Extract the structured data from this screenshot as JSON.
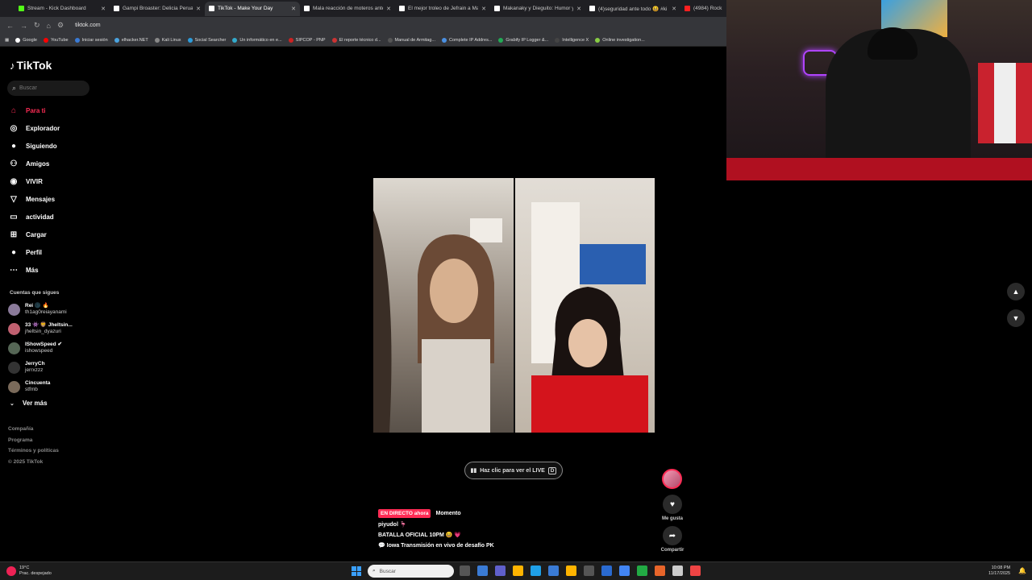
{
  "browser": {
    "tabs": [
      {
        "title": "Stream - Kick Dashboard",
        "color": "#53fc18",
        "active": false
      },
      {
        "title": "Gampi Broaster: Delicia Peruana",
        "color": "#ffffff",
        "active": false
      },
      {
        "title": "TikTok - Make Your Day",
        "color": "#ffffff",
        "active": true
      },
      {
        "title": "Mala reacción de moteros ante",
        "color": "#ffffff",
        "active": false
      },
      {
        "title": "El mejor troleo de Jefrain a Mai",
        "color": "#ffffff",
        "active": false
      },
      {
        "title": "Makanaky y Dieguito: Humor y",
        "color": "#ffffff",
        "active": false
      },
      {
        "title": "(4)seguridad ante todo 😆 #ki",
        "color": "#ffffff",
        "active": false
      },
      {
        "title": "(4984) Rock",
        "color": "#ff2020",
        "active": false
      }
    ],
    "url": "tiktok.com",
    "bookmarks": [
      {
        "label": "Google",
        "color": "#ffffff"
      },
      {
        "label": "YouTube",
        "color": "#ff0000"
      },
      {
        "label": "Iniciar sesión",
        "color": "#3a7bd5"
      },
      {
        "label": "elhacker.NET",
        "color": "#4aa3df"
      },
      {
        "label": "Kali Linux",
        "color": "#888888"
      },
      {
        "label": "Social Searcher",
        "color": "#2d9cdb"
      },
      {
        "label": "Un informático en e...",
        "color": "#33aacc"
      },
      {
        "label": "SIPCOP - PNP",
        "color": "#cc2222"
      },
      {
        "label": "El reporte técnico d...",
        "color": "#cc3333"
      },
      {
        "label": "Manual de Armitag...",
        "color": "#555555"
      },
      {
        "label": "Complete IP Addres...",
        "color": "#4a90e2"
      },
      {
        "label": "Grabify IP Logger &...",
        "color": "#22aa55"
      },
      {
        "label": "Intelligence X",
        "color": "#444444"
      },
      {
        "label": "Online investigation...",
        "color": "#88cc44"
      }
    ]
  },
  "tiktok": {
    "logo": "TikTok",
    "search_placeholder": "Buscar",
    "menu": [
      {
        "label": "Para ti",
        "icon": "home-icon",
        "selected": true
      },
      {
        "label": "Explorador",
        "icon": "compass-icon",
        "selected": false
      },
      {
        "label": "Siguiendo",
        "icon": "following-icon",
        "selected": false
      },
      {
        "label": "Amigos",
        "icon": "friends-icon",
        "selected": false
      },
      {
        "label": "VIVIR",
        "icon": "live-icon",
        "selected": false
      },
      {
        "label": "Mensajes",
        "icon": "messages-icon",
        "selected": false
      },
      {
        "label": "actividad",
        "icon": "activity-icon",
        "selected": false
      },
      {
        "label": "Cargar",
        "icon": "upload-icon",
        "selected": false
      },
      {
        "label": "Perfil",
        "icon": "profile-icon",
        "selected": false
      },
      {
        "label": "Más",
        "icon": "more-icon",
        "selected": false
      }
    ],
    "following_title": "Cuentas que sigues",
    "following": [
      {
        "name": "Rei 🌑 🔥",
        "handle": "th1ag0reiayanami",
        "color": "#8a7a9a"
      },
      {
        "name": "33 👾 🦁 Jheltsin...",
        "handle": "jheltsin_dyazuri",
        "color": "#c06070"
      },
      {
        "name": "IShowSpeed ✔",
        "handle": "ishowspeed",
        "color": "#556655"
      },
      {
        "name": "JerryCh",
        "handle": "jerrxzzz",
        "color": "#333333"
      },
      {
        "name": "Cincuenta",
        "handle": "stfmb",
        "color": "#7a6a5a"
      }
    ],
    "see_more": "Ver más",
    "footer": [
      "Compañía",
      "Programa",
      "Términos y políticas",
      "© 2025 TikTok"
    ],
    "live_button": "Haz clic para ver el LIVE",
    "live_key": "D",
    "live_badge": "EN DIRECTO ahora",
    "moment": "Momento",
    "username": "piyudol 🦩",
    "caption_line1": "BATALLA OFICIAL 10PM 😆 💗",
    "caption_line2": "💬 Iowa   Transmisión en vivo de desafío PK",
    "like_label": "Me gusta",
    "share_label": "Compartir"
  },
  "taskbar": {
    "temperature": "19°C",
    "weather": "Prac. despejado",
    "search_placeholder": "Buscar",
    "time": "10:08 PM",
    "date": "11/17/2025",
    "app_colors": [
      "#555555",
      "#3a7bd5",
      "#6060cc",
      "#ffb400",
      "#1fa0e8",
      "#3a7bd5",
      "#ffb400",
      "#555555",
      "#2a6ad0",
      "#4285f4",
      "#22aa44",
      "#e8652a",
      "#cccccc",
      "#e44"
    ]
  }
}
